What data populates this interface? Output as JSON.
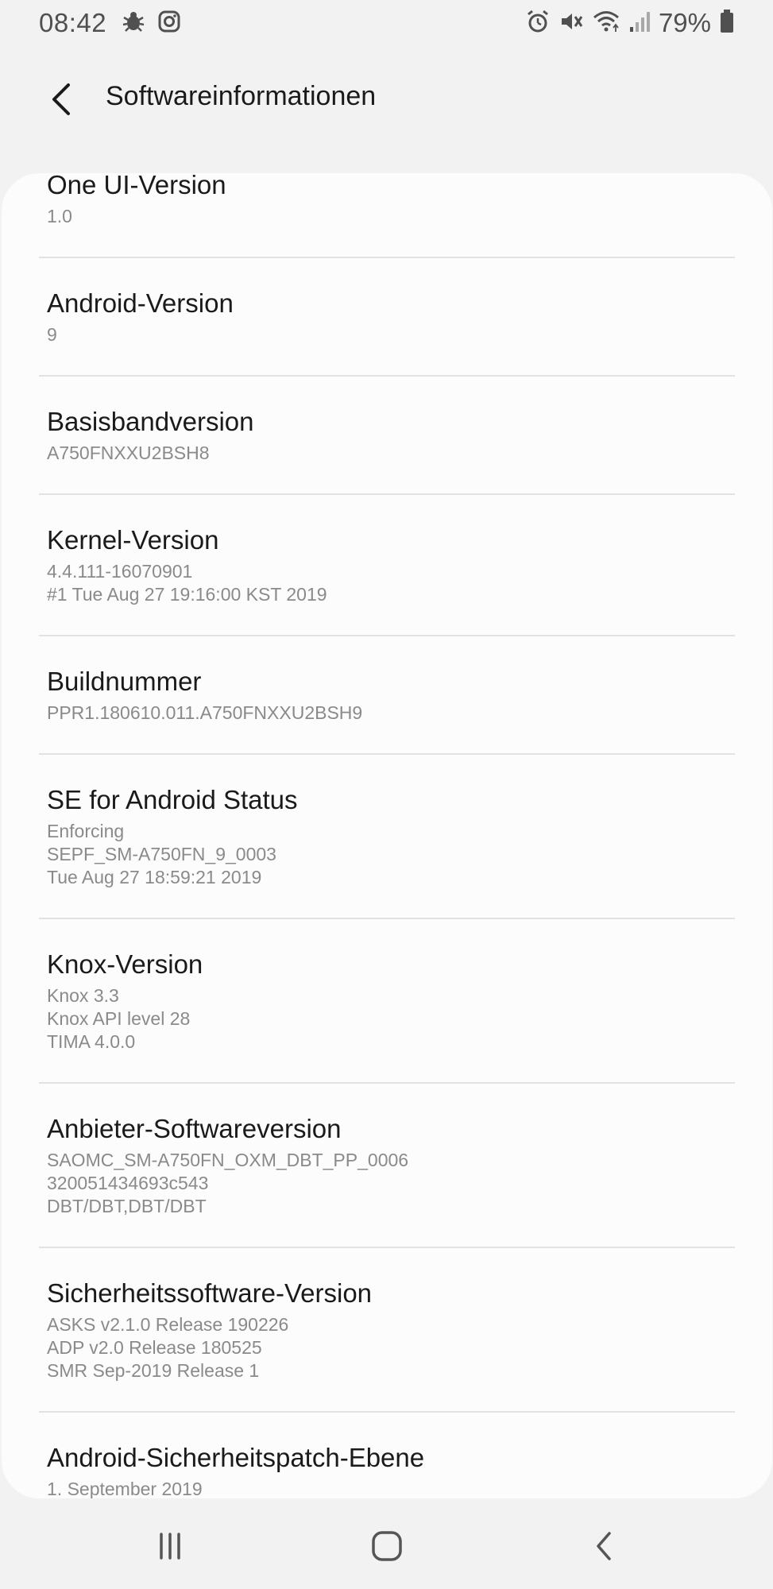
{
  "status_bar": {
    "time": "08:42",
    "left_icons": [
      "bug-icon",
      "instagram-icon"
    ],
    "right_icons": [
      "alarm-icon",
      "mute-icon",
      "wifi-icon",
      "signal-icon",
      "battery-icon"
    ],
    "battery_percent": "79%"
  },
  "header": {
    "title": "Softwareinformationen",
    "back_icon": "chevron-left-icon"
  },
  "items": [
    {
      "label": "One UI-Version",
      "values": [
        "1.0"
      ]
    },
    {
      "label": "Android-Version",
      "values": [
        "9"
      ]
    },
    {
      "label": "Basisbandversion",
      "values": [
        "A750FNXXU2BSH8"
      ]
    },
    {
      "label": "Kernel-Version",
      "values": [
        "4.4.111-16070901",
        "#1 Tue Aug 27 19:16:00 KST 2019"
      ]
    },
    {
      "label": "Buildnummer",
      "values": [
        "PPR1.180610.011.A750FNXXU2BSH9"
      ]
    },
    {
      "label": "SE for Android Status",
      "values": [
        "Enforcing",
        "SEPF_SM-A750FN_9_0003",
        "Tue Aug 27 18:59:21 2019"
      ]
    },
    {
      "label": "Knox-Version",
      "values": [
        "Knox 3.3",
        "Knox API level 28",
        "TIMA 4.0.0"
      ]
    },
    {
      "label": "Anbieter-Softwareversion",
      "values": [
        "SAOMC_SM-A750FN_OXM_DBT_PP_0006",
        "320051434693c543",
        "DBT/DBT,DBT/DBT"
      ]
    },
    {
      "label": "Sicherheitssoftware-Version",
      "values": [
        "ASKS v2.1.0 Release 190226",
        "ADP v2.0 Release 180525",
        "SMR Sep-2019 Release 1"
      ]
    },
    {
      "label": "Android-Sicherheitspatch-Ebene",
      "values": [
        "1. September 2019"
      ]
    }
  ],
  "nav_bar": {
    "recents_icon": "recents-icon",
    "home_icon": "home-icon",
    "back_icon": "back-icon"
  }
}
